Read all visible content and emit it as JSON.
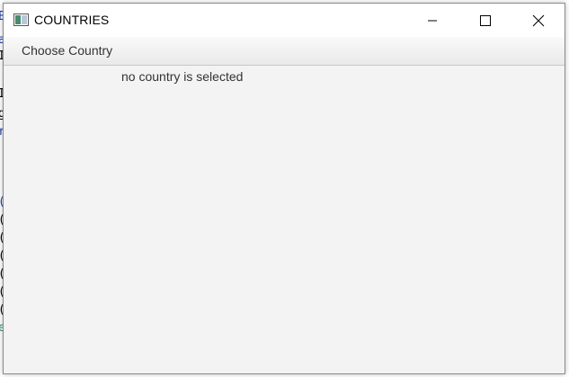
{
  "window": {
    "title": "COUNTRIES",
    "controls": {
      "minimize": "minimize-icon",
      "maximize": "maximize-icon",
      "close": "close-icon"
    }
  },
  "menubar": {
    "items": [
      {
        "label": "Choose Country"
      }
    ]
  },
  "content": {
    "status_text": "no country is selected"
  },
  "colors": {
    "window_bg": "#f3f3f3",
    "titlebar_bg": "#ffffff",
    "text": "#333333"
  }
}
